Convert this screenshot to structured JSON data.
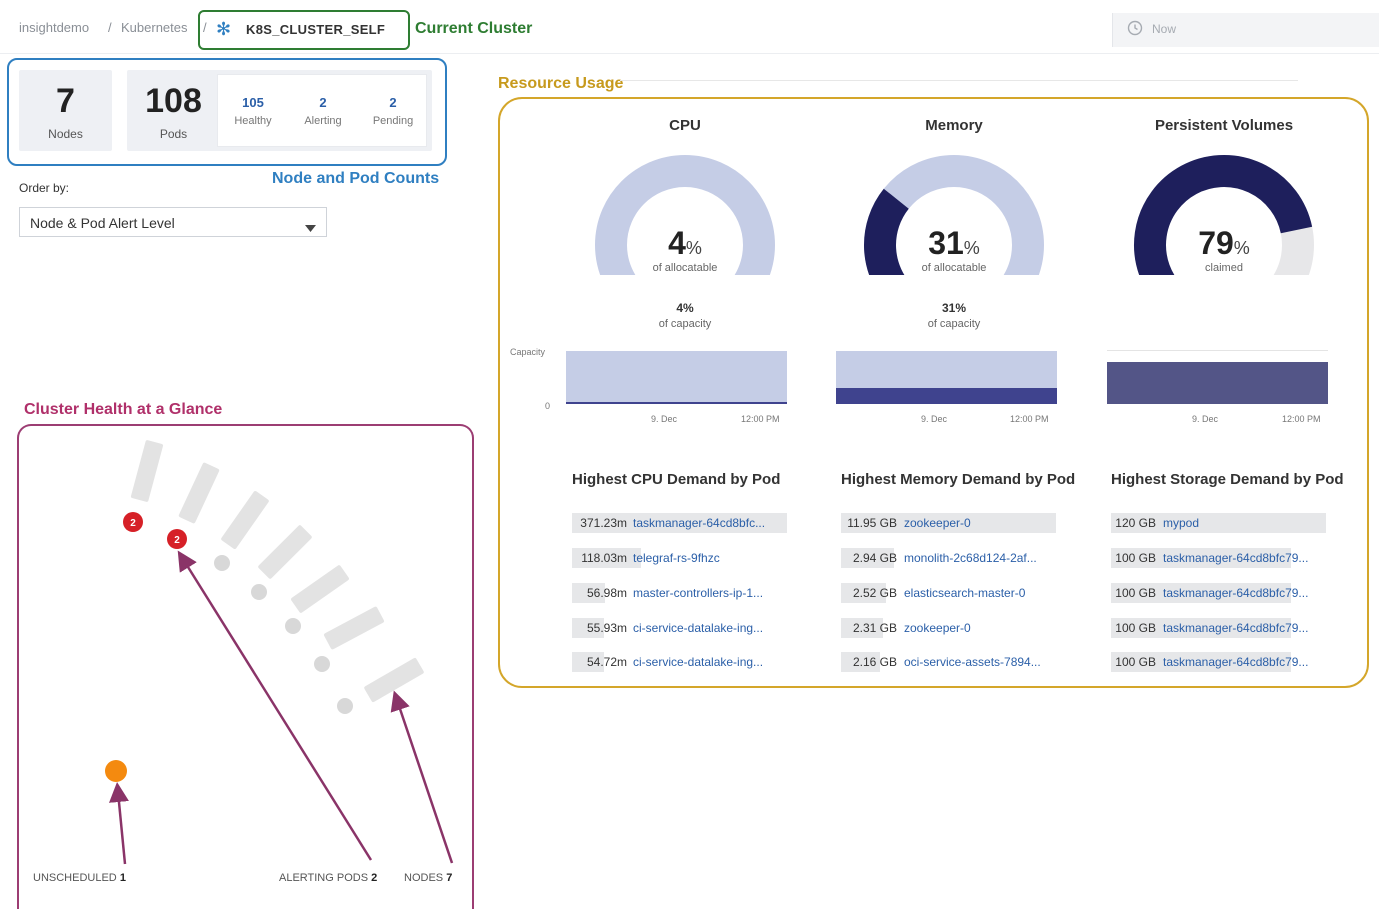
{
  "breadcrumb": {
    "items": [
      "insightdemo",
      "/",
      "Kubernetes",
      "/"
    ],
    "cluster": "K8S_CLUSTER_SELF",
    "annotation": "Current Cluster"
  },
  "time_picker": {
    "value": "Now"
  },
  "counts": {
    "nodes": {
      "value": "7",
      "label": "Nodes"
    },
    "pods": {
      "value": "108",
      "label": "Pods"
    },
    "healthy": {
      "value": "105",
      "label": "Healthy"
    },
    "alerting": {
      "value": "2",
      "label": "Alerting"
    },
    "pending": {
      "value": "2",
      "label": "Pending"
    },
    "annotation": "Node and Pod Counts"
  },
  "order_by": {
    "label": "Order by:",
    "value": "Node & Pod Alert Level"
  },
  "health": {
    "annotation": "Cluster Health at a Glance",
    "alert_badge_1": "2",
    "alert_badge_2": "2",
    "unscheduled_label": "UNSCHEDULED",
    "unscheduled_count": "1",
    "alerting_label": "ALERTING PODS",
    "alerting_count": "2",
    "nodes_label": "NODES",
    "nodes_count": "7"
  },
  "resource_usage": {
    "annotation": "Resource Usage",
    "capacity_axis": "Capacity",
    "zero_axis": "0",
    "columns": [
      {
        "title": "CPU",
        "gauge_value": "4",
        "gauge_unit": "%",
        "gauge_caption": "of allocatable",
        "gauge_fraction": 0.04,
        "capacity_value": "4%",
        "capacity_caption": "of capacity",
        "x_ticks": [
          "9. Dec",
          "12:00 PM"
        ],
        "demand_title": "Highest CPU Demand by Pod",
        "rows": [
          {
            "value": "371.23m",
            "name": "taskmanager-64cd8bfc..."
          },
          {
            "value": "118.03m",
            "name": "telegraf-rs-9fhzc"
          },
          {
            "value": "56.98m",
            "name": "master-controllers-ip-1..."
          },
          {
            "value": "55.93m",
            "name": "ci-service-datalake-ing..."
          },
          {
            "value": "54.72m",
            "name": "ci-service-datalake-ing..."
          }
        ]
      },
      {
        "title": "Memory",
        "gauge_value": "31",
        "gauge_unit": "%",
        "gauge_caption": "of allocatable",
        "gauge_fraction": 0.31,
        "capacity_value": "31%",
        "capacity_caption": "of capacity",
        "x_ticks": [
          "9. Dec",
          "12:00 PM"
        ],
        "demand_title": "Highest Memory Demand by Pod",
        "rows": [
          {
            "value": "11.95 GB",
            "name": "zookeeper-0"
          },
          {
            "value": "2.94 GB",
            "name": "monolith-2c68d124-2af..."
          },
          {
            "value": "2.52 GB",
            "name": "elasticsearch-master-0"
          },
          {
            "value": "2.31 GB",
            "name": "zookeeper-0"
          },
          {
            "value": "2.16 GB",
            "name": "oci-service-assets-7894..."
          }
        ]
      },
      {
        "title": "Persistent Volumes",
        "gauge_value": "79",
        "gauge_unit": "%",
        "gauge_caption": "claimed",
        "gauge_fraction": 0.79,
        "x_ticks": [
          "9. Dec",
          "12:00 PM"
        ],
        "demand_title": "Highest Storage Demand by Pod",
        "rows": [
          {
            "value": "120 GB",
            "name": "mypod"
          },
          {
            "value": "100 GB",
            "name": "taskmanager-64cd8bfc79..."
          },
          {
            "value": "100 GB",
            "name": "taskmanager-64cd8bfc79..."
          },
          {
            "value": "100 GB",
            "name": "taskmanager-64cd8bfc79..."
          },
          {
            "value": "100 GB",
            "name": "taskmanager-64cd8bfc79..."
          }
        ]
      }
    ]
  },
  "colors": {
    "gauge_fill": "#1e1f5c",
    "gauge_track": "#c5cde6",
    "gauge_track_grey": "#e7e7e9",
    "area_light": "#c5cde6",
    "area_dark": "#3f438e",
    "area_pv": "#535587",
    "alert_red": "#d62027",
    "unscheduled_orange": "#f48a0f"
  }
}
